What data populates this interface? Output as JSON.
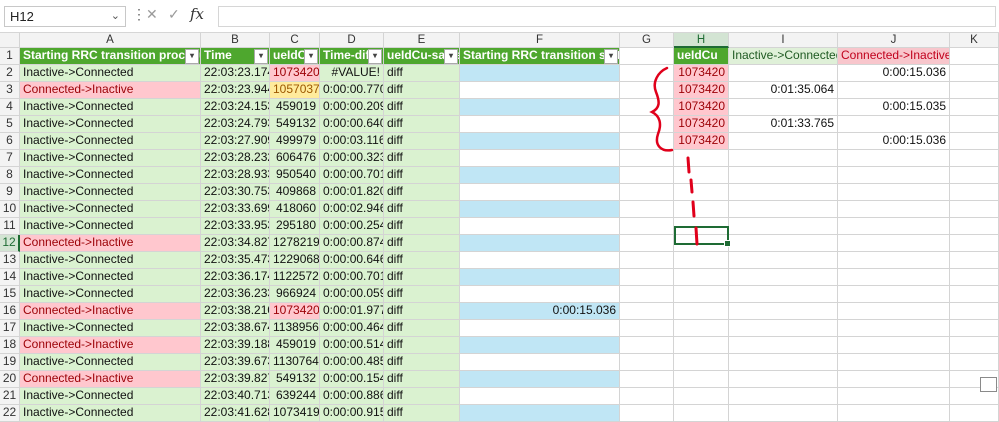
{
  "formula_bar": {
    "name_box": "H12",
    "name_box_icon": "chevron-down-icon",
    "menu_icon": "more-vertical-icon",
    "cancel_icon": "close-icon",
    "enter_icon": "check-icon",
    "fx_label": "fx",
    "formula": ""
  },
  "columns": [
    "A",
    "B",
    "C",
    "D",
    "E",
    "F",
    "G",
    "H",
    "I",
    "J",
    "K"
  ],
  "selected_column": "H",
  "selected_row": "12",
  "rows": [
    "1",
    "2",
    "3",
    "4",
    "5",
    "6",
    "7",
    "8",
    "9",
    "10",
    "11",
    "12",
    "13",
    "14",
    "15",
    "16",
    "17",
    "18",
    "19",
    "20",
    "21",
    "22"
  ],
  "table": {
    "headers": [
      "Starting RRC transition procedure",
      "Time",
      "ueIdCu",
      "Time-diff",
      "ueIdCu-same",
      "Starting RRC transition status"
    ],
    "filter_icon": "filter-dropdown-icon",
    "filter_glyph": "▾",
    "rows": [
      {
        "a": "Inactive->Connected",
        "b": "22:03:23.174",
        "c": "1073420",
        "d": "#VALUE!",
        "e": "diff",
        "f": ""
      },
      {
        "a": "Connected->Inactive",
        "b": "22:03:23.944",
        "c": "1057037",
        "d": "0:00:00.770",
        "e": "diff",
        "f": ""
      },
      {
        "a": "Inactive->Connected",
        "b": "22:03:24.153",
        "c": "459019",
        "d": "0:00:00.209",
        "e": "diff",
        "f": ""
      },
      {
        "a": "Inactive->Connected",
        "b": "22:03:24.793",
        "c": "549132",
        "d": "0:00:00.640",
        "e": "diff",
        "f": ""
      },
      {
        "a": "Inactive->Connected",
        "b": "22:03:27.909",
        "c": "499979",
        "d": "0:00:03.116",
        "e": "diff",
        "f": ""
      },
      {
        "a": "Inactive->Connected",
        "b": "22:03:28.232",
        "c": "606476",
        "d": "0:00:00.323",
        "e": "diff",
        "f": ""
      },
      {
        "a": "Inactive->Connected",
        "b": "22:03:28.933",
        "c": "950540",
        "d": "0:00:00.701",
        "e": "diff",
        "f": ""
      },
      {
        "a": "Inactive->Connected",
        "b": "22:03:30.753",
        "c": "409868",
        "d": "0:00:01.820",
        "e": "diff",
        "f": ""
      },
      {
        "a": "Inactive->Connected",
        "b": "22:03:33.699",
        "c": "418060",
        "d": "0:00:02.946",
        "e": "diff",
        "f": ""
      },
      {
        "a": "Inactive->Connected",
        "b": "22:03:33.953",
        "c": "295180",
        "d": "0:00:00.254",
        "e": "diff",
        "f": ""
      },
      {
        "a": "Connected->Inactive",
        "b": "22:03:34.827",
        "c": "1278219",
        "d": "0:00:00.874",
        "e": "diff",
        "f": ""
      },
      {
        "a": "Inactive->Connected",
        "b": "22:03:35.473",
        "c": "1229068",
        "d": "0:00:00.646",
        "e": "diff",
        "f": ""
      },
      {
        "a": "Inactive->Connected",
        "b": "22:03:36.174",
        "c": "1122572",
        "d": "0:00:00.701",
        "e": "diff",
        "f": ""
      },
      {
        "a": "Inactive->Connected",
        "b": "22:03:36.233",
        "c": "966924",
        "d": "0:00:00.059",
        "e": "diff",
        "f": ""
      },
      {
        "a": "Connected->Inactive",
        "b": "22:03:38.210",
        "c": "1073420",
        "d": "0:00:01.977",
        "e": "diff",
        "f": "0:00:15.036"
      },
      {
        "a": "Inactive->Connected",
        "b": "22:03:38.674",
        "c": "1138956",
        "d": "0:00:00.464",
        "e": "diff",
        "f": ""
      },
      {
        "a": "Connected->Inactive",
        "b": "22:03:39.188",
        "c": "459019",
        "d": "0:00:00.514",
        "e": "diff",
        "f": ""
      },
      {
        "a": "Inactive->Connected",
        "b": "22:03:39.673",
        "c": "1130764",
        "d": "0:00:00.485",
        "e": "diff",
        "f": ""
      },
      {
        "a": "Connected->Inactive",
        "b": "22:03:39.827",
        "c": "549132",
        "d": "0:00:00.154",
        "e": "diff",
        "f": ""
      },
      {
        "a": "Inactive->Connected",
        "b": "22:03:40.713",
        "c": "639244",
        "d": "0:00:00.886",
        "e": "diff",
        "f": ""
      },
      {
        "a": "Inactive->Connected",
        "b": "22:03:41.628",
        "c": "1073419",
        "d": "0:00:00.915",
        "e": "diff",
        "f": ""
      }
    ]
  },
  "summary": {
    "headers": [
      "ueIdCu",
      "Inactive->Connected",
      "Connected->Inactive"
    ],
    "rows": [
      {
        "h": "1073420",
        "i": "",
        "j": "0:00:15.036"
      },
      {
        "h": "1073420",
        "i": "0:01:35.064",
        "j": ""
      },
      {
        "h": "1073420",
        "i": "",
        "j": "0:00:15.035"
      },
      {
        "h": "1073420",
        "i": "0:01:33.765",
        "j": ""
      },
      {
        "h": "1073420",
        "i": "",
        "j": "0:00:15.036"
      }
    ]
  },
  "colors": {
    "header_green": "#4ea72e",
    "connected_inactive_fill": "#ffc7ce",
    "inactive_connected_fill": "#daf2d0",
    "status_fill": "#c0e6f5",
    "duplicate_text": "#9c0006",
    "ink": "#e0001b"
  }
}
